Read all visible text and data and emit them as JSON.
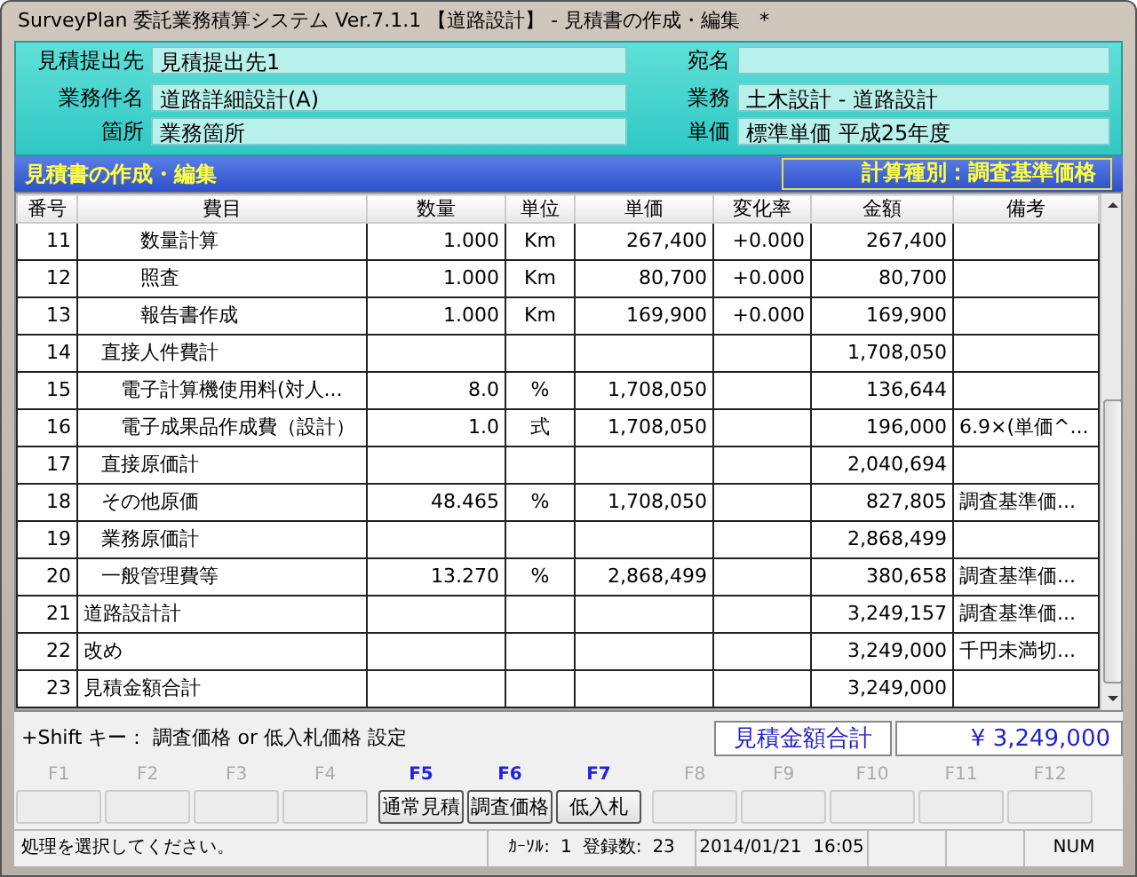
{
  "window": {
    "title": "SurveyPlan 委託業務積算システム Ver.7.1.1 【道路設計】 - 見積書の作成・編集　*"
  },
  "header": {
    "rows": [
      {
        "left": {
          "label": "見積提出先",
          "value": "見積提出先1"
        },
        "right": {
          "label": "宛名"
        }
      },
      {
        "left": {
          "label": "業務件名",
          "value": "道路詳細設計(A)"
        },
        "right": {
          "label": "業務",
          "value": "土木設計 - 道路設計"
        }
      },
      {
        "left": {
          "label": "箇所",
          "value": "業務箇所"
        },
        "right": {
          "label": "単価",
          "value": "標準単価 平成25年度"
        }
      }
    ]
  },
  "section": {
    "title": "見積書の作成・編集",
    "calc_type": "計算種別：調査基準価格"
  },
  "table": {
    "columns": [
      "番号",
      "費目",
      "数量",
      "単位",
      "単価",
      "変化率",
      "金額",
      "備考"
    ],
    "rows": [
      {
        "kind": "work",
        "no": "11",
        "item": "数量計算",
        "qty": "1.000",
        "unit": "Km",
        "price": "267,400",
        "rate": "+0.000",
        "amount": "267,400"
      },
      {
        "kind": "work",
        "no": "12",
        "item": "照査",
        "qty": "1.000",
        "unit": "Km",
        "price": "80,700",
        "rate": "+0.000",
        "amount": "80,700"
      },
      {
        "kind": "work",
        "no": "13",
        "item": "報告書作成",
        "qty": "1.000",
        "unit": "Km",
        "price": "169,900",
        "rate": "+0.000",
        "amount": "169,900"
      },
      {
        "kind": "cost",
        "no": "14",
        "item": "直接人件費計",
        "amount": "1,708,050"
      },
      {
        "kind": "expense",
        "no": "15",
        "item": "電子計算機使用料(対人...",
        "qty": "8.0",
        "unit": "%",
        "price": "1,708,050",
        "amount": "136,644"
      },
      {
        "kind": "expense",
        "no": "16",
        "item": "電子成果品作成費（設計）",
        "qty": "1.0",
        "unit": "式",
        "price": "1,708,050",
        "amount": "196,000",
        "note": "6.9×(単価^..."
      },
      {
        "kind": "cost",
        "no": "17",
        "item": "直接原価計",
        "amount": "2,040,694"
      },
      {
        "kind": "cost",
        "no": "18",
        "item": "その他原価",
        "qty": "48.465",
        "unit": "%",
        "price": "1,708,050",
        "amount": "827,805",
        "note": "調査基準価..."
      },
      {
        "kind": "cost",
        "no": "19",
        "item": "業務原価計",
        "amount": "2,868,499"
      },
      {
        "kind": "cost",
        "no": "20",
        "item": "一般管理費等",
        "qty": "13.270",
        "unit": "%",
        "price": "2,868,499",
        "amount": "380,658",
        "note": "調査基準価..."
      },
      {
        "kind": "total",
        "no": "21",
        "item": "道路設計計",
        "amount": "3,249,157",
        "note": "調査基準価..."
      },
      {
        "kind": "total",
        "no": "22",
        "item": "改め",
        "amount": "3,249,000",
        "note": "千円未満切..."
      },
      {
        "kind": "total",
        "no": "23",
        "item": "見積金額合計",
        "amount": "3,249,000"
      }
    ]
  },
  "hint": "+Shift キー： 調査価格 or 低入札価格 設定",
  "total": {
    "label": "見積金額合計",
    "value": "¥ 3,249,000"
  },
  "function_keys": [
    {
      "key": "F1",
      "enabled": false
    },
    {
      "key": "F2",
      "enabled": false
    },
    {
      "key": "F3",
      "enabled": false
    },
    {
      "key": "F4",
      "enabled": false
    },
    {
      "key": "F5",
      "enabled": true,
      "label": "通常見積"
    },
    {
      "key": "F6",
      "enabled": true,
      "label": "調査価格"
    },
    {
      "key": "F7",
      "enabled": true,
      "label": "低入札"
    },
    {
      "key": "F8",
      "enabled": false
    },
    {
      "key": "F9",
      "enabled": false
    },
    {
      "key": "F10",
      "enabled": false
    },
    {
      "key": "F11",
      "enabled": false
    },
    {
      "key": "F12",
      "enabled": false
    }
  ],
  "status_bar": {
    "message": "処理を選択してください。",
    "cursor_label": "ｶｰｿﾙ:",
    "cursor": "1",
    "count_label": "登録数:",
    "count": "23",
    "datetime": "2014/01/21  16:05",
    "num": "NUM"
  }
}
